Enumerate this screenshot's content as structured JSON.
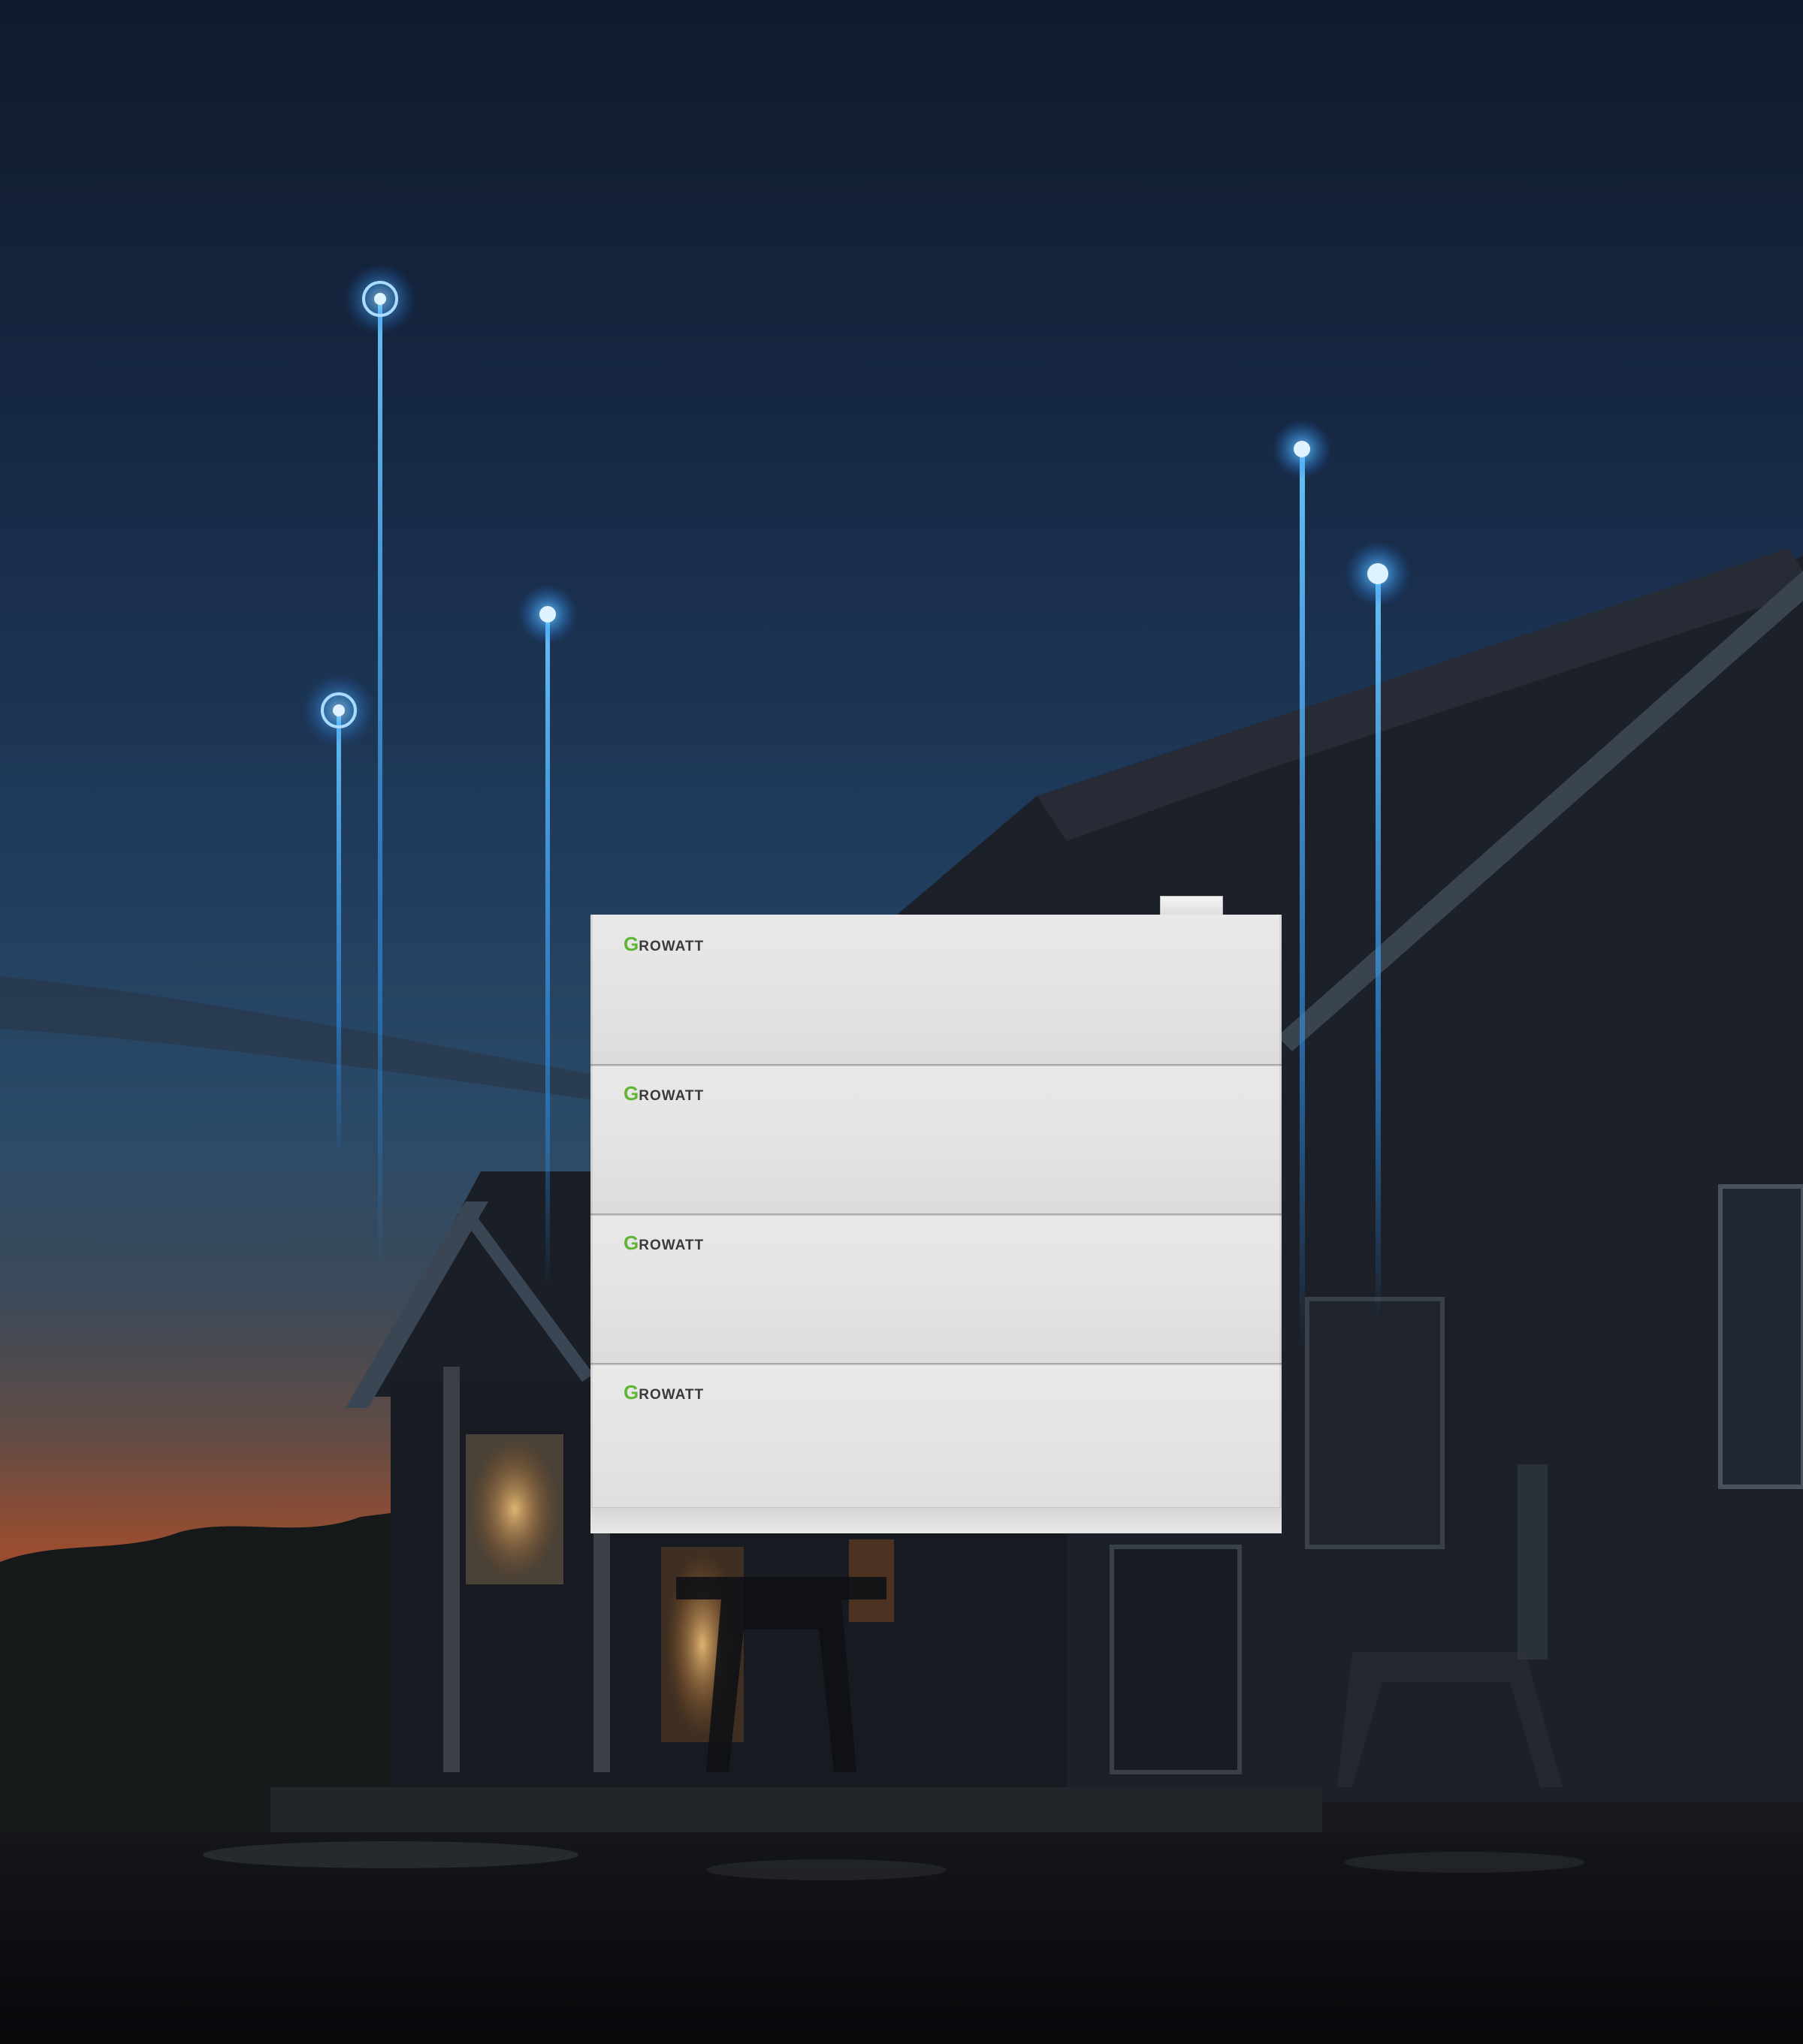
{
  "scene": {
    "description_tag": "night-house-with-battery",
    "sky_colors": [
      "#101a2c",
      "#1b2f4e",
      "#2b4a6c",
      "#5a4e52",
      "#b5552f"
    ],
    "glow_color": "#3fa9ff"
  },
  "battery": {
    "brand_initial": "G",
    "brand_rest": "ROWATT",
    "brand_color": "#5fb534",
    "modules": [
      {
        "brand_initial": "G",
        "brand_rest": "ROWATT"
      },
      {
        "brand_initial": "G",
        "brand_rest": "ROWATT"
      },
      {
        "brand_initial": "G",
        "brand_rest": "ROWATT"
      },
      {
        "brand_initial": "G",
        "brand_rest": "ROWATT"
      }
    ]
  }
}
